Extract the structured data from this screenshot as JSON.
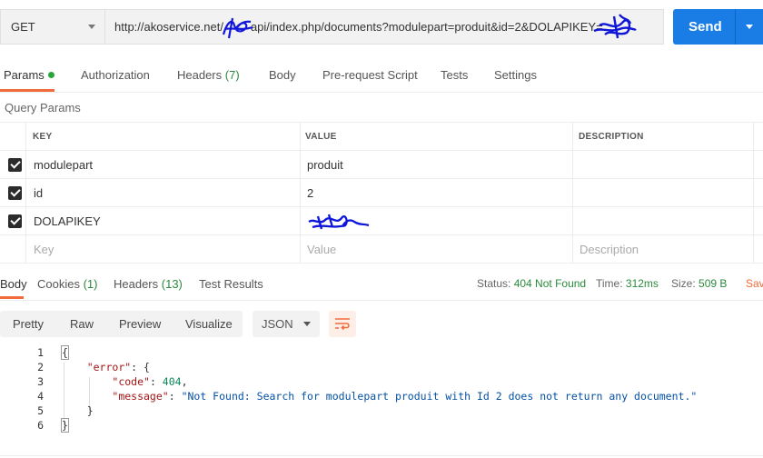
{
  "request": {
    "method": "GET",
    "url_prefix": "http://akoservice.net/",
    "url_mid": "api/index.php/documents?modulepart=produit&id=2&DOLAPIKEY=",
    "send_label": "Send"
  },
  "request_tabs": [
    {
      "label": "Params"
    },
    {
      "label": "Authorization"
    },
    {
      "label": "Headers",
      "count": "(7)"
    },
    {
      "label": "Body"
    },
    {
      "label": "Pre-request Script"
    },
    {
      "label": "Tests"
    },
    {
      "label": "Settings"
    }
  ],
  "query_params_title": "Query Params",
  "params_table": {
    "headers": [
      "KEY",
      "VALUE",
      "DESCRIPTION"
    ],
    "rows": [
      {
        "key": "modulepart",
        "value": "produit",
        "checked": true
      },
      {
        "key": "id",
        "value": "2",
        "checked": true
      },
      {
        "key": "DOLAPIKEY",
        "value": "",
        "checked": true
      }
    ],
    "placeholder": {
      "key": "Key",
      "value": "Value",
      "description": "Description"
    }
  },
  "response_tabs": [
    {
      "label": "Body"
    },
    {
      "label": "Cookies",
      "count": "(1)"
    },
    {
      "label": "Headers",
      "count": "(13)"
    },
    {
      "label": "Test Results"
    }
  ],
  "response_status": {
    "status_label": "Status:",
    "status_value": "404 Not Found",
    "time_label": "Time:",
    "time_value": "312ms",
    "size_label": "Size:",
    "size_value": "509 B",
    "save_label": "Sav"
  },
  "view_modes": [
    "Pretty",
    "Raw",
    "Preview",
    "Visualize"
  ],
  "format": "JSON",
  "code_lines": [
    {
      "num": "1",
      "text": "{"
    },
    {
      "num": "2",
      "key": "\"error\"",
      "rest": ": {"
    },
    {
      "num": "3",
      "key": "\"code\"",
      "rest": ": ",
      "number": "404",
      "tail": ","
    },
    {
      "num": "4",
      "key": "\"message\"",
      "rest": ": ",
      "string": "\"Not Found: Search for modulepart produit with Id 2 does not return any document.\""
    },
    {
      "num": "5",
      "text": "}"
    },
    {
      "num": "6",
      "text": "}"
    }
  ],
  "colors": {
    "accent": "#f26b3a",
    "send": "#1a7de6",
    "success": "#2a8a3c",
    "scribble": "#1016d8"
  }
}
